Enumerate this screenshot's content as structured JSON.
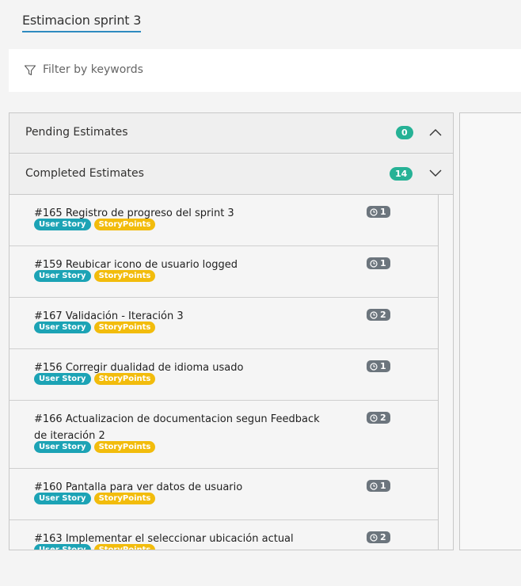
{
  "tab": {
    "title": "Estimacion sprint 3"
  },
  "filter": {
    "placeholder": "Filter by keywords",
    "icon": "filter-icon"
  },
  "sections": {
    "pending": {
      "title": "Pending Estimates",
      "count": "0",
      "expanded": false
    },
    "completed": {
      "title": "Completed Estimates",
      "count": "14",
      "expanded": true
    }
  },
  "colors": {
    "accent": "#2e8bc0",
    "count_badge": "#26b296",
    "user_story_tag": "#1ca3b5",
    "storypoints_tag": "#f2bc0c",
    "estimate_badge": "#6c757d"
  },
  "items": [
    {
      "title": "#165 Registro de progreso del sprint 3",
      "tags": [
        "User Story",
        "StoryPoints"
      ],
      "estimate": "1"
    },
    {
      "title": "#159 Reubicar icono de usuario logged",
      "tags": [
        "User Story",
        "StoryPoints"
      ],
      "estimate": "1"
    },
    {
      "title": "#167 Validación - Iteración 3",
      "tags": [
        "User Story",
        "StoryPoints"
      ],
      "estimate": "2"
    },
    {
      "title": "#156 Corregir dualidad de idioma usado",
      "tags": [
        "User Story",
        "StoryPoints"
      ],
      "estimate": "1"
    },
    {
      "title": "#166 Actualizacion de documentacion segun Feedback de iteración 2",
      "tags": [
        "User Story",
        "StoryPoints"
      ],
      "estimate": "2"
    },
    {
      "title": "#160 Pantalla para ver datos de usuario",
      "tags": [
        "User Story",
        "StoryPoints"
      ],
      "estimate": "1"
    },
    {
      "title": "#163 Implementar el seleccionar ubicación actual",
      "tags": [
        "User Story",
        "StoryPoints"
      ],
      "estimate": "2"
    }
  ]
}
